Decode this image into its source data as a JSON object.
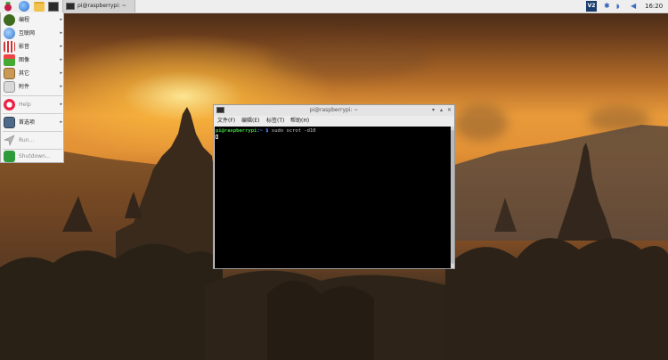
{
  "taskbar": {
    "task_title": "pi@raspberrypi: ~",
    "vnc_label": "V2",
    "clock": "16:20",
    "icons": [
      "raspberry-icon",
      "globe-icon",
      "folder-icon",
      "terminal-icon",
      "bluetooth-icon",
      "wifi-icon",
      "volume-icon"
    ]
  },
  "menu": {
    "items": [
      {
        "label": "编程",
        "icon": "programming-icon",
        "arrow": "▸"
      },
      {
        "label": "互联网",
        "icon": "internet-icon",
        "arrow": "▸"
      },
      {
        "label": "影音",
        "icon": "sound-video-icon",
        "arrow": "▸"
      },
      {
        "label": "图像",
        "icon": "graphics-icon",
        "arrow": "▸"
      },
      {
        "label": "其它",
        "icon": "accessories-icon",
        "arrow": "▸"
      },
      {
        "label": "附件",
        "icon": "system-tools-icon",
        "arrow": "▸"
      },
      {
        "label": "Help",
        "icon": "help-icon",
        "arrow": "▸"
      },
      {
        "label": "首选项",
        "icon": "preferences-icon",
        "arrow": "▸"
      },
      {
        "label": "Run...",
        "icon": "run-icon"
      },
      {
        "label": "Shutdown...",
        "icon": "shutdown-icon"
      }
    ]
  },
  "terminal": {
    "title": "pi@raspberrypi: ~",
    "menus": [
      "文件(F)",
      "编辑(E)",
      "标签(T)",
      "帮助(H)"
    ],
    "prompt_user": "pi@raspberrypi",
    "prompt_path": ":~ $",
    "command": " sudo scrot -d10",
    "window_buttons": {
      "minimize": "▾",
      "maximize": "▴",
      "close": "✕"
    }
  },
  "colors": {
    "taskbar_bg": "#eeeeee",
    "terminal_bg": "#000000",
    "prompt_green": "#43d043",
    "path_blue": "#5b8cff"
  }
}
